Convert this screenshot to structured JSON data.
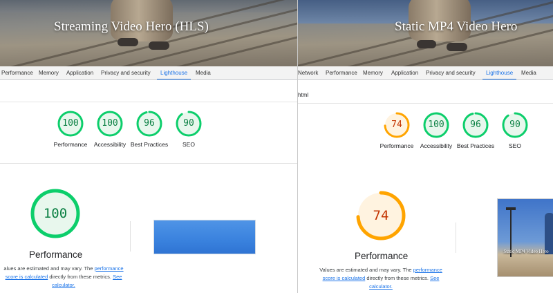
{
  "panels": [
    {
      "id": "left",
      "hero_title": "Streaming Video Hero (HLS)",
      "tabs": [
        {
          "label": "Performance",
          "active": false
        },
        {
          "label": "Memory",
          "active": false
        },
        {
          "label": "Application",
          "active": false
        },
        {
          "label": "Privacy and security",
          "active": false
        },
        {
          "label": "Lighthouse",
          "active": true
        },
        {
          "label": "Media",
          "active": false
        }
      ],
      "url_text": "",
      "scores": [
        {
          "value": "100",
          "label": "Performance",
          "status": "pass"
        },
        {
          "value": "100",
          "label": "Accessibility",
          "status": "pass"
        },
        {
          "value": "96",
          "label": "Best Practices",
          "status": "pass"
        },
        {
          "value": "90",
          "label": "SEO",
          "status": "pass"
        }
      ],
      "big_score": {
        "value": "100",
        "label": "Performance",
        "status": "pass"
      },
      "note": {
        "t1": "alues are estimated and may vary. The ",
        "link1": "performance",
        "link2": "score is calculated",
        "t2": " directly from these metrics. ",
        "link3": "See",
        "link4": "calculator."
      }
    },
    {
      "id": "right",
      "hero_title": "Static MP4 Video Hero",
      "tabs": [
        {
          "label": "Network",
          "active": false
        },
        {
          "label": "Performance",
          "active": false
        },
        {
          "label": "Memory",
          "active": false
        },
        {
          "label": "Application",
          "active": false
        },
        {
          "label": "Privacy and security",
          "active": false
        },
        {
          "label": "Lighthouse",
          "active": true
        },
        {
          "label": "Media",
          "active": false
        }
      ],
      "url_text": "html",
      "scores": [
        {
          "value": "74",
          "label": "Performance",
          "status": "average"
        },
        {
          "value": "100",
          "label": "Accessibility",
          "status": "pass"
        },
        {
          "value": "96",
          "label": "Best Practices",
          "status": "pass"
        },
        {
          "value": "90",
          "label": "SEO",
          "status": "pass"
        }
      ],
      "big_score": {
        "value": "74",
        "label": "Performance",
        "status": "average"
      },
      "note": {
        "t1": "Values are estimated and may vary. The ",
        "link1": "performance",
        "link2": "score is calculated",
        "t2": " directly from these metrics. ",
        "link3": "See",
        "link4": "calculator."
      },
      "thumbnail_title": "Static MP4 Video Hero"
    }
  ],
  "colors": {
    "pass_ring": "#0cce6b",
    "pass_fill": "#e8f7ed",
    "pass_text": "#0b8043",
    "average_ring": "#ffa400",
    "average_fill": "#fff3e0",
    "average_text": "#c33300",
    "accent": "#1a73e8"
  },
  "icons": {
    "score_gauge": "score-gauge-icon"
  }
}
